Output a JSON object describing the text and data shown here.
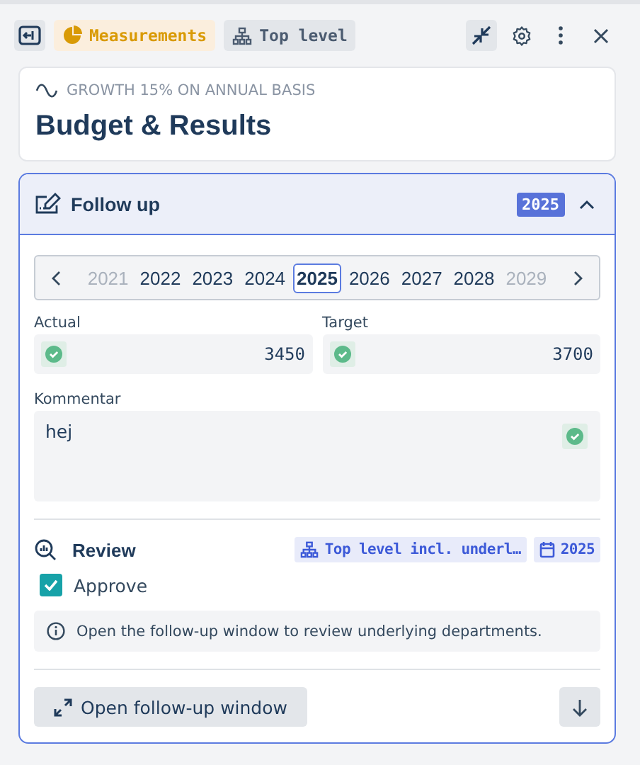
{
  "toolbar": {
    "chips": [
      {
        "kind": "measure",
        "label": "Measurements"
      },
      {
        "kind": "level",
        "label": "Top level"
      }
    ],
    "collapse_active": true
  },
  "header": {
    "subtitle": "GROWTH 15% ON ANNUAL BASIS",
    "title": "Budget & Results"
  },
  "followup": {
    "title": "Follow up",
    "badge": "2025",
    "expanded": true,
    "years": [
      {
        "label": "2021",
        "selected": false,
        "faded": true
      },
      {
        "label": "2022",
        "selected": false,
        "faded": false
      },
      {
        "label": "2023",
        "selected": false,
        "faded": false
      },
      {
        "label": "2024",
        "selected": false,
        "faded": false
      },
      {
        "label": "2025",
        "selected": true,
        "faded": false
      },
      {
        "label": "2026",
        "selected": false,
        "faded": false
      },
      {
        "label": "2027",
        "selected": false,
        "faded": false
      },
      {
        "label": "2028",
        "selected": false,
        "faded": false
      },
      {
        "label": "2029",
        "selected": false,
        "faded": true
      }
    ],
    "fields": [
      {
        "label": "Actual",
        "value": "3450",
        "valid": true
      },
      {
        "label": "Target",
        "value": "3700",
        "valid": true
      }
    ],
    "comment": {
      "label": "Kommentar",
      "value": "hej",
      "valid": true
    },
    "review": {
      "title": "Review",
      "scope": "Top level incl. underl…",
      "year": "2025",
      "approve": {
        "label": "Approve",
        "checked": true
      },
      "info": "Open the follow-up window to review underlying departments."
    },
    "open_button": "Open follow-up window"
  }
}
